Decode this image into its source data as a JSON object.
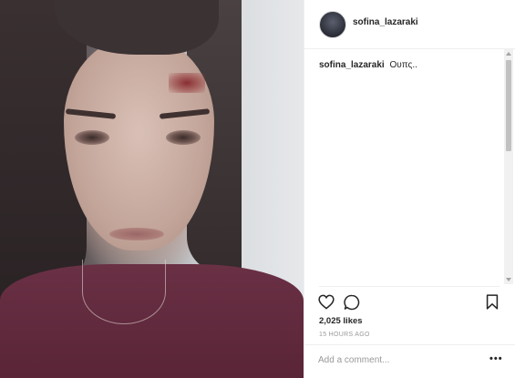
{
  "post": {
    "username": "sofina_lazaraki",
    "caption_user": "sofina_lazaraki",
    "caption_text": "Ουπς..",
    "likes": "2,025 likes",
    "timestamp": "15 HOURS AGO",
    "comment_placeholder": "Add a comment...",
    "more_label": "•••"
  },
  "icons": {
    "heart": "heart-icon",
    "comment": "comment-icon",
    "bookmark": "bookmark-icon"
  }
}
